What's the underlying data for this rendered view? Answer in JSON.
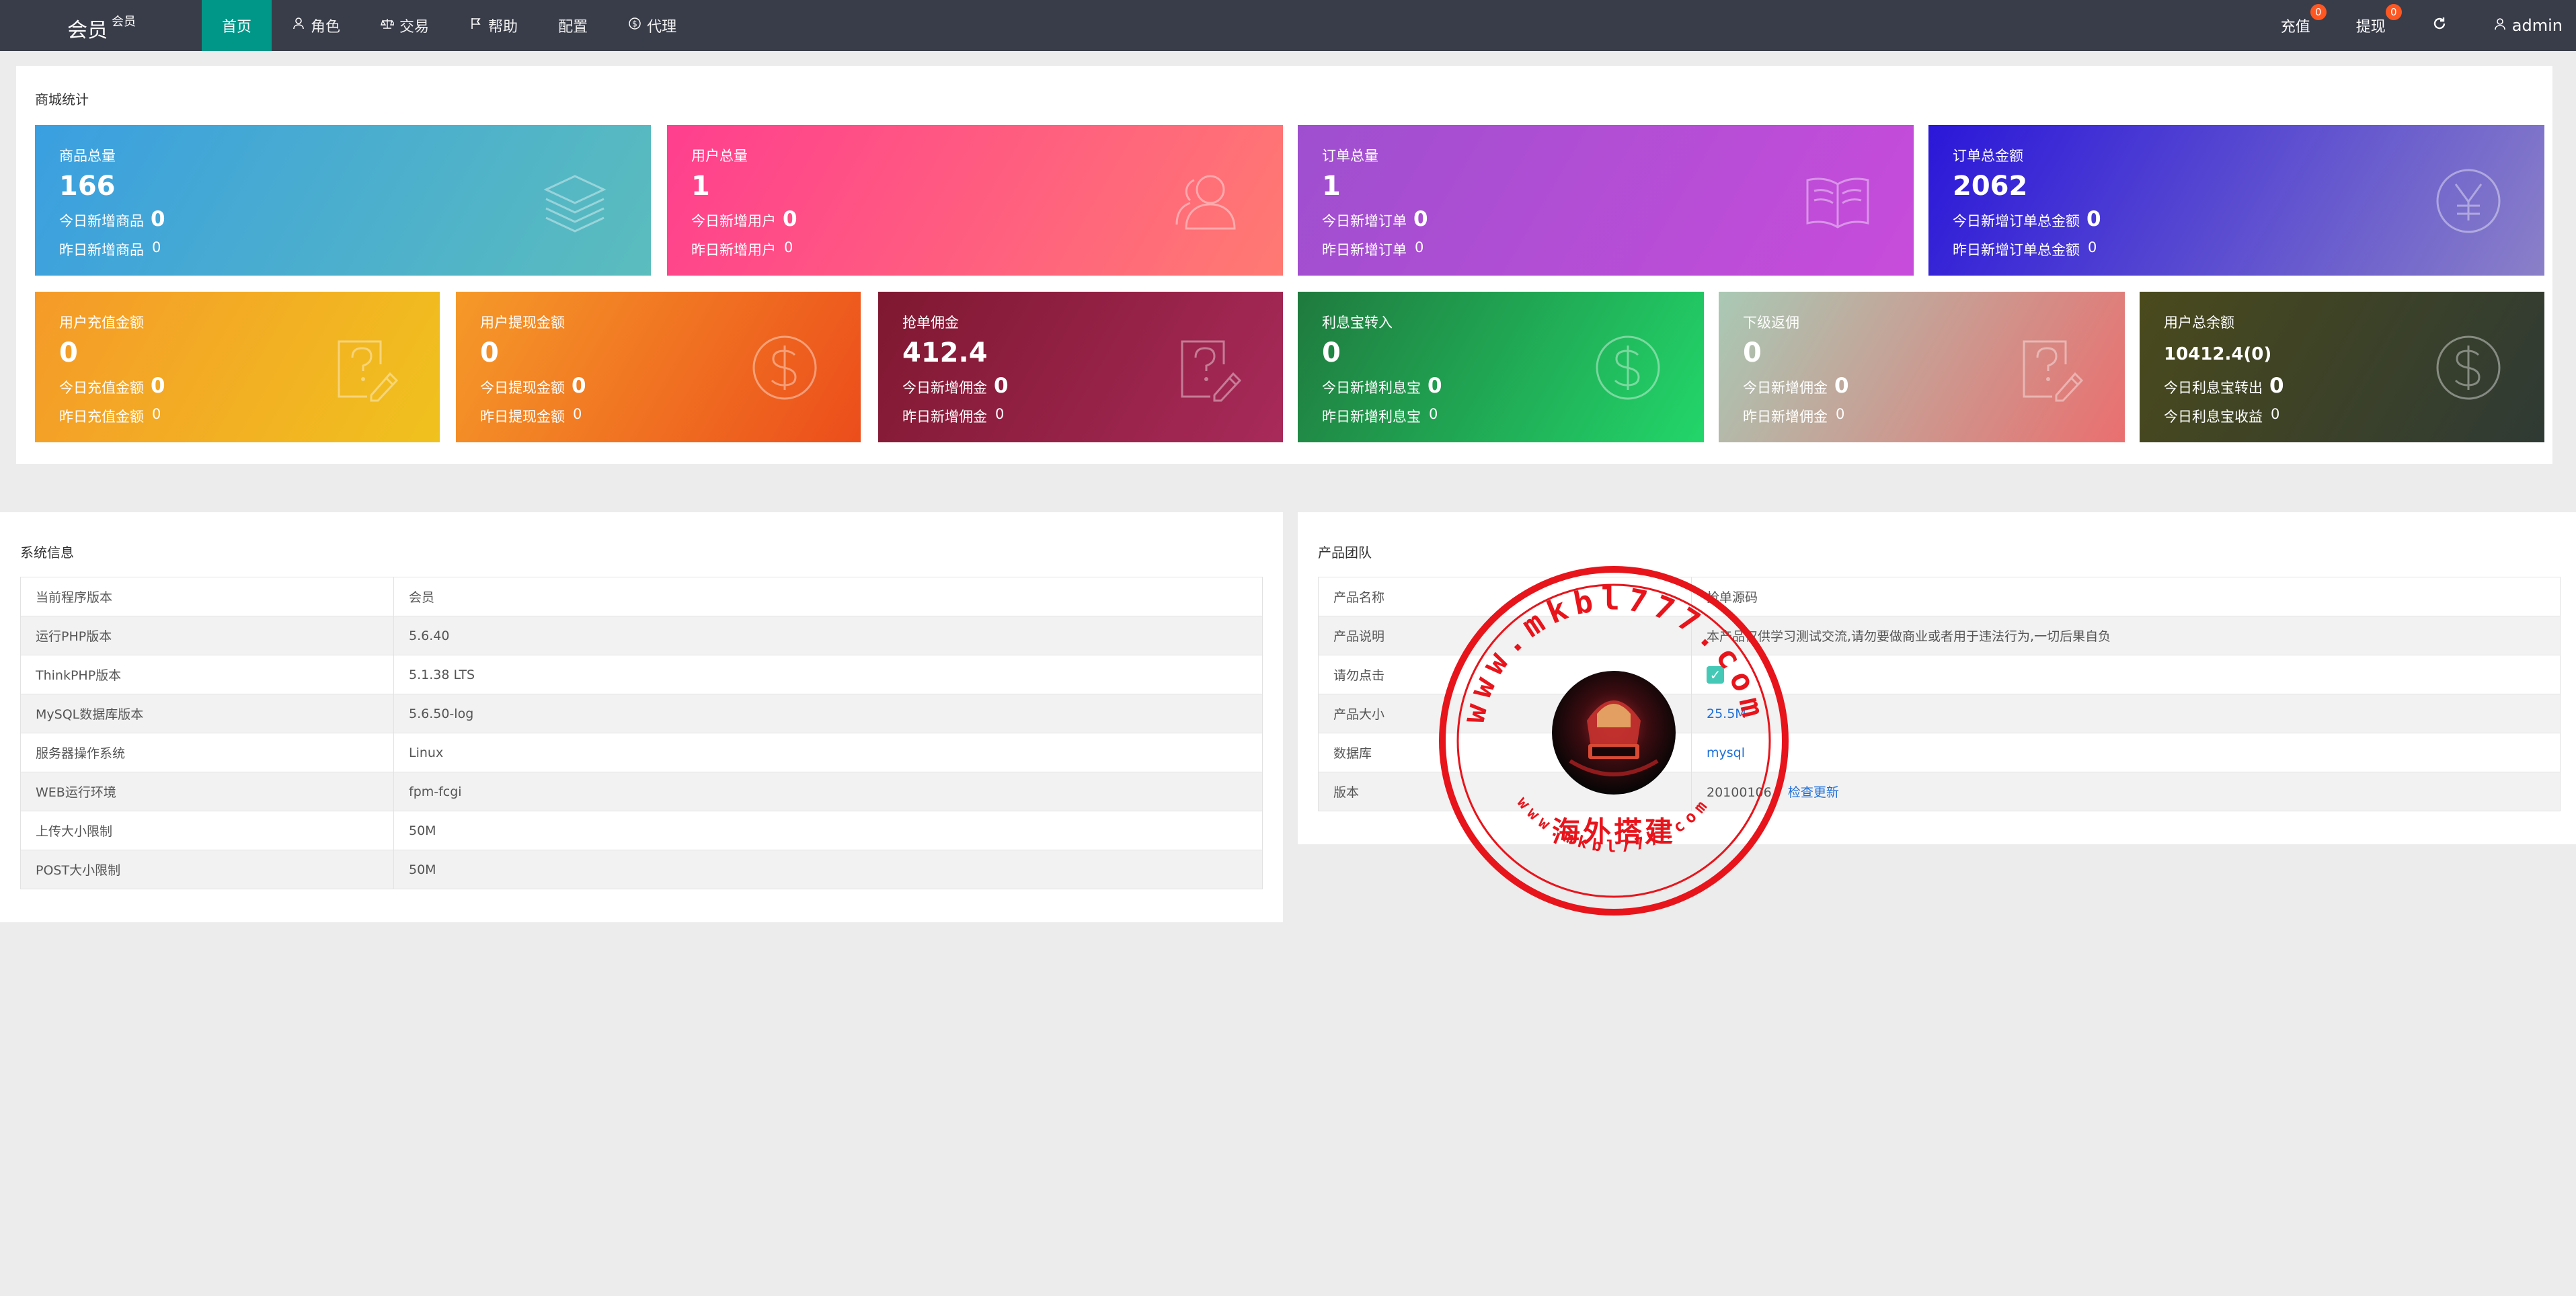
{
  "nav": {
    "brand": "会员",
    "brand_sub": "会员",
    "items": [
      {
        "label": "首页",
        "icon": "home-icon",
        "active": true
      },
      {
        "label": "角色",
        "icon": "user-icon"
      },
      {
        "label": "交易",
        "icon": "scale-icon"
      },
      {
        "label": "帮助",
        "icon": "flag-icon"
      },
      {
        "label": "配置",
        "icon": ""
      },
      {
        "label": "代理",
        "icon": "dollar-circle-icon"
      }
    ],
    "recharge_label": "充值",
    "recharge_badge": "0",
    "withdraw_label": "提现",
    "withdraw_badge": "0",
    "refresh_icon": "refresh-icon",
    "user_label": "admin"
  },
  "stats": {
    "title": "商城统计",
    "cards": [
      {
        "title": "商品总量",
        "value": "166",
        "line1_label": "今日新增商品",
        "line1_value": "0",
        "line2_label": "昨日新增商品",
        "line2_value": "0",
        "icon": "layers-icon",
        "gradient": [
          "#3a9fe0",
          "#5bbdbd"
        ]
      },
      {
        "title": "用户总量",
        "value": "1",
        "line1_label": "今日新增用户",
        "line1_value": "0",
        "line2_label": "昨日新增用户",
        "line2_value": "0",
        "icon": "users-icon",
        "gradient": [
          "#ff3f8e",
          "#ff7a72"
        ]
      },
      {
        "title": "订单总量",
        "value": "1",
        "line1_label": "今日新增订单",
        "line1_value": "0",
        "line2_label": "昨日新增订单",
        "line2_value": "0",
        "icon": "book-icon",
        "gradient": [
          "#9e4fcf",
          "#c84cdb"
        ]
      },
      {
        "title": "订单总金额",
        "value": "2062",
        "line1_label": "今日新增订单总金额",
        "line1_value": "0",
        "line2_label": "昨日新增订单总金额",
        "line2_value": "0",
        "icon": "yen-icon",
        "gradient": [
          "#2a17d9",
          "#8a80c8"
        ]
      },
      {
        "title": "用户充值金额",
        "value": "0",
        "line1_label": "今日充值金额",
        "line1_value": "0",
        "line2_label": "昨日充值金额",
        "line2_value": "0",
        "icon": "question-edit-icon",
        "gradient": [
          "#f59a29",
          "#f0c21e"
        ]
      },
      {
        "title": "用户提现金额",
        "value": "0",
        "line1_label": "今日提现金额",
        "line1_value": "0",
        "line2_label": "昨日提现金额",
        "line2_value": "0",
        "icon": "dollar-circle-icon",
        "gradient": [
          "#f59a29",
          "#ec4d1b"
        ]
      },
      {
        "title": "抢单佣金",
        "value": "412.4",
        "line1_label": "今日新增佣金",
        "line1_value": "0",
        "line2_label": "昨日新增佣金",
        "line2_value": "0",
        "icon": "question-edit-icon",
        "gradient": [
          "#7f1830",
          "#a82a5a"
        ]
      },
      {
        "title": "利息宝转入",
        "value": "0",
        "line1_label": "今日新增利息宝",
        "line1_value": "0",
        "line2_label": "昨日新增利息宝",
        "line2_value": "0",
        "icon": "dollar-circle-icon",
        "gradient": [
          "#1f7a3e",
          "#22d66a"
        ]
      },
      {
        "title": "下级返佣",
        "value": "0",
        "line1_label": "今日新增佣金",
        "line1_value": "0",
        "line2_label": "昨日新增佣金",
        "line2_value": "0",
        "icon": "question-edit-icon",
        "gradient": [
          "#a9c9b5",
          "#ea6f6f"
        ]
      },
      {
        "title": "用户总余额",
        "value": "10412.4(0)",
        "line1_label": "今日利息宝转出",
        "line1_value": "0",
        "line2_label": "今日利息宝收益",
        "line2_value": "0",
        "icon": "dollar-circle-icon",
        "gradient": [
          "#4a4a1c",
          "#2f3a34"
        ]
      }
    ]
  },
  "system": {
    "title": "系统信息",
    "rows": [
      {
        "label": "当前程序版本",
        "value": "会员"
      },
      {
        "label": "运行PHP版本",
        "value": "5.6.40"
      },
      {
        "label": "ThinkPHP版本",
        "value": "5.1.38 LTS"
      },
      {
        "label": "MySQL数据库版本",
        "value": "5.6.50-log"
      },
      {
        "label": "服务器操作系统",
        "value": "Linux"
      },
      {
        "label": "WEB运行环境",
        "value": "fpm-fcgi"
      },
      {
        "label": "上传大小限制",
        "value": "50M"
      },
      {
        "label": "POST大小限制",
        "value": "50M"
      }
    ]
  },
  "team": {
    "title": "产品团队",
    "rows": [
      {
        "label": "产品名称",
        "value": "抢单源码"
      },
      {
        "label": "产品说明",
        "value": "本产品仅供学习测试交流,请勿要做商业或者用于违法行为,一切后果自负"
      },
      {
        "label": "请勿点击",
        "value": ""
      },
      {
        "label": "产品大小",
        "value": "25.5M"
      },
      {
        "label": "数据库",
        "value": "mysql"
      },
      {
        "label": "版本",
        "value": "20100106",
        "link": "检查更新"
      }
    ]
  },
  "stamp": {
    "top_text": "www.mkbl777.com",
    "center_text": "海外搭建",
    "bottom_text": "www.mkbl777.com",
    "color": "#e8141b"
  }
}
